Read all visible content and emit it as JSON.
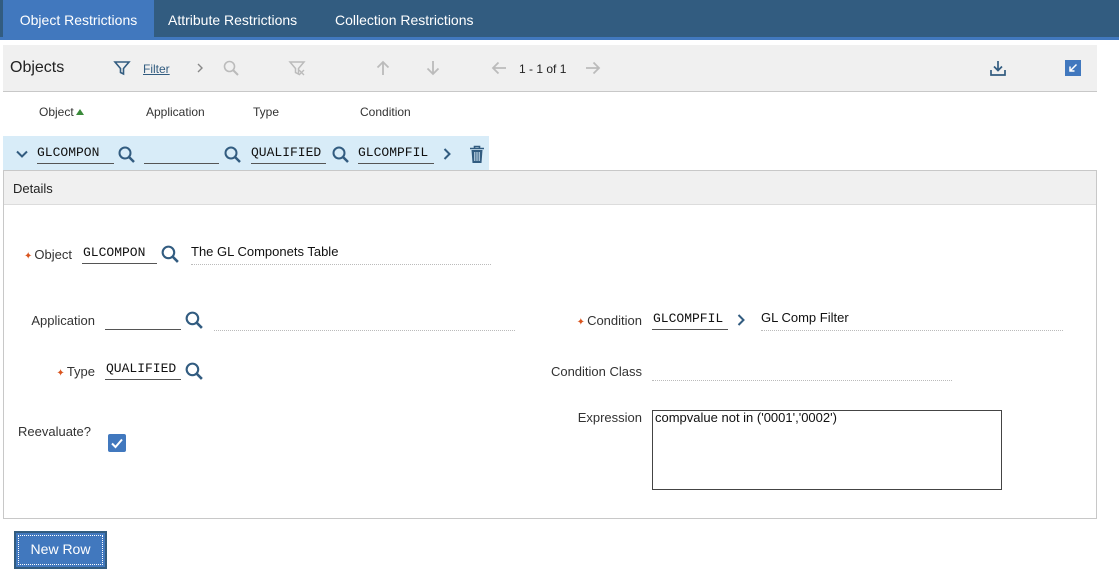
{
  "tabs": [
    {
      "label": "Object Restrictions",
      "active": true
    },
    {
      "label": "Attribute Restrictions",
      "active": false
    },
    {
      "label": "Collection Restrictions",
      "active": false
    }
  ],
  "toolbar": {
    "title": "Objects",
    "filter_label": "Filter",
    "pager": "1 - 1 of 1"
  },
  "grid": {
    "columns": [
      "Object",
      "Application",
      "Type",
      "Condition"
    ],
    "row": {
      "object": "GLCOMPON",
      "application": "",
      "type": "QUALIFIED",
      "condition": "GLCOMPFIL"
    }
  },
  "details": {
    "title": "Details",
    "object_label": "Object",
    "object_value": "GLCOMPON",
    "object_desc": "The GL Componets Table",
    "application_label": "Application",
    "application_value": "",
    "application_desc": "",
    "condition_label": "Condition",
    "condition_value": "GLCOMPFIL",
    "condition_desc": "GL Comp Filter",
    "type_label": "Type",
    "type_value": "QUALIFIED",
    "condition_class_label": "Condition Class",
    "condition_class_value": "",
    "reevaluate_label": "Reevaluate?",
    "reevaluate_checked": true,
    "expression_label": "Expression",
    "expression_value": "compvalue not in ('0001','0002')"
  },
  "buttons": {
    "new_row": "New Row"
  },
  "colors": {
    "tab_bar": "#325c80",
    "accent": "#4178be",
    "selected_row": "#d8ecf8",
    "required": "#d9541e"
  }
}
